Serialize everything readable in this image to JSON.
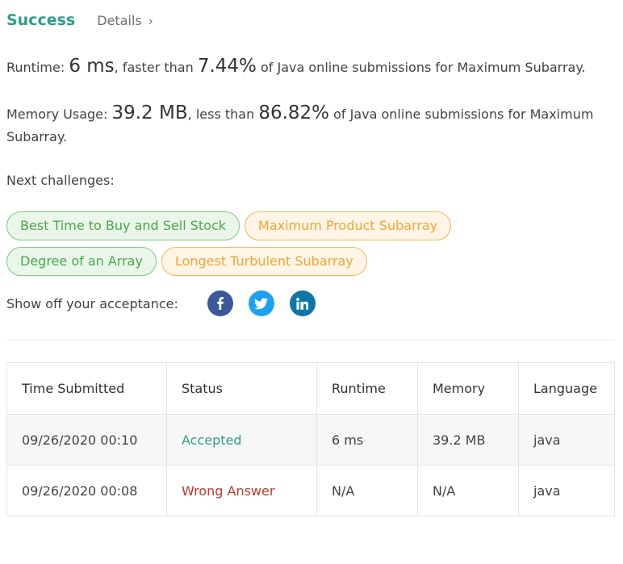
{
  "header": {
    "status": "Success",
    "details_label": "Details",
    "details_chevron": "›"
  },
  "runtime": {
    "label": "Runtime: ",
    "value": "6 ms",
    "mid": ", faster than ",
    "percent": "7.44%",
    "suffix": " of Java online submissions for Maximum Subarray."
  },
  "memory": {
    "label": "Memory Usage: ",
    "value": "39.2 MB",
    "mid": ", less than ",
    "percent": "86.82%",
    "suffix": " of Java online submissions for Maximum Subarray."
  },
  "next_challenges": {
    "label": "Next challenges:",
    "items": [
      {
        "label": "Best Time to Buy and Sell Stock",
        "difficulty": "easy"
      },
      {
        "label": "Maximum Product Subarray",
        "difficulty": "medium"
      },
      {
        "label": "Degree of an Array",
        "difficulty": "easy"
      },
      {
        "label": "Longest Turbulent Subarray",
        "difficulty": "medium"
      }
    ]
  },
  "share": {
    "label": "Show off your acceptance:",
    "icons": [
      "facebook-icon",
      "twitter-icon",
      "linkedin-icon"
    ]
  },
  "table": {
    "headers": [
      "Time Submitted",
      "Status",
      "Runtime",
      "Memory",
      "Language"
    ],
    "rows": [
      {
        "time": "09/26/2020 00:10",
        "status": "Accepted",
        "runtime": "6 ms",
        "memory": "39.2 MB",
        "language": "java"
      },
      {
        "time": "09/26/2020 00:08",
        "status": "Wrong Answer",
        "runtime": "N/A",
        "memory": "N/A",
        "language": "java"
      }
    ]
  },
  "colors": {
    "success": "#2e9e8a",
    "wrong_answer": "#c0392b",
    "easy": "#4aa84a",
    "medium": "#f0a536"
  }
}
